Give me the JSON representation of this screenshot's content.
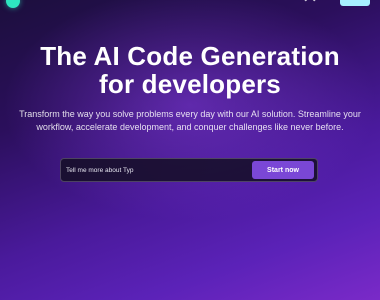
{
  "hero": {
    "title_line1": "The AI Code Generation",
    "title_line2": "for developers",
    "subtitle": "Transform the way you solve problems every day with our AI solution. Streamline your workflow, accelerate development, and conquer challenges like never before."
  },
  "search": {
    "value": "Tell me more about Typ",
    "button_label": "Start now"
  },
  "colors": {
    "accent": "#7a47d6",
    "logo": "#2ee6c0",
    "nav_cta": "#a8f0ff"
  },
  "icons": {
    "logo": "logo-icon",
    "nav": "chevron-icon"
  }
}
